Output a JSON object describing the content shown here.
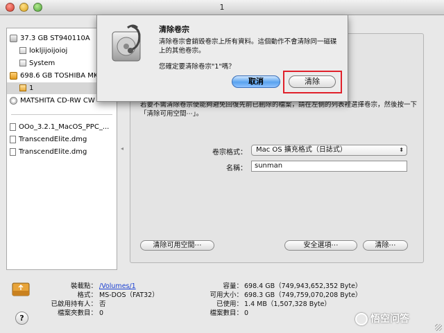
{
  "window": {
    "title": "1"
  },
  "sidebar": {
    "items": [
      {
        "label": "37.3 GB ST940110A",
        "icon": "hard-disk-icon"
      },
      {
        "label": "lokljijoijoioj",
        "icon": "volume-icon"
      },
      {
        "label": "System",
        "icon": "volume-icon"
      },
      {
        "label": "698.6 GB TOSHIBA MK",
        "icon": "external-disk-icon"
      },
      {
        "label": "1",
        "icon": "external-volume-icon",
        "selected": true
      },
      {
        "label": "MATSHITA CD-RW CW",
        "icon": "cd-drive-icon"
      },
      {
        "label": "OOo_3.2.1_MacOS_PPC_...",
        "icon": "disk-image-icon"
      },
      {
        "label": "TranscendElite.dmg",
        "icon": "disk-image-icon"
      },
      {
        "label": "TranscendElite.dmg",
        "icon": "disk-image-icon"
      }
    ]
  },
  "erase_panel": {
    "instructions": "若要不需清除卷宗便能夠避免回復先前已刪除的檔案，請在左側的列表裡選擇卷宗，然後按一下「清除可用空間⋯」。",
    "format_label": "卷宗格式：",
    "format_value": "Mac OS 擴充格式（日誌式）",
    "name_label": "名稱：",
    "name_value": "sunman",
    "erase_free_space_button": "清除可用空間⋯",
    "security_options_button": "安全選項⋯",
    "erase_button": "清除⋯"
  },
  "info": {
    "mount_point_label": "裝載點：",
    "mount_point_value": "/Volumes/1",
    "format_label": "格式：",
    "format_value": "MS-DOS（FAT32）",
    "owners_label": "已啟用持有人：",
    "owners_value": "否",
    "folders_label": "檔案夾數目：",
    "folders_value": "0",
    "capacity_label": "容量：",
    "capacity_value": "698.4 GB（749,943,652,352 Byte）",
    "available_label": "可用大小：",
    "available_value": "698.3 GB（749,759,070,208 Byte）",
    "used_label": "已使用：",
    "used_value": "1.4 MB（1,507,328 Byte）",
    "files_label": "檔案數目：",
    "files_value": "0"
  },
  "sheet": {
    "title": "清除卷宗",
    "message": "清除卷宗會銷毀卷宗上所有資料。這個動作不會清除同一磁碟上的其他卷宗。",
    "question": "您確定要清除卷宗\"1\"嗎？",
    "cancel_button": "取消",
    "erase_button": "清除"
  },
  "help_button": "?",
  "watermark": "悟空问答",
  "colors": {
    "accent_blue": "#5aa3ef",
    "highlight_red": "#e0202a",
    "link": "#1a3fd1"
  }
}
